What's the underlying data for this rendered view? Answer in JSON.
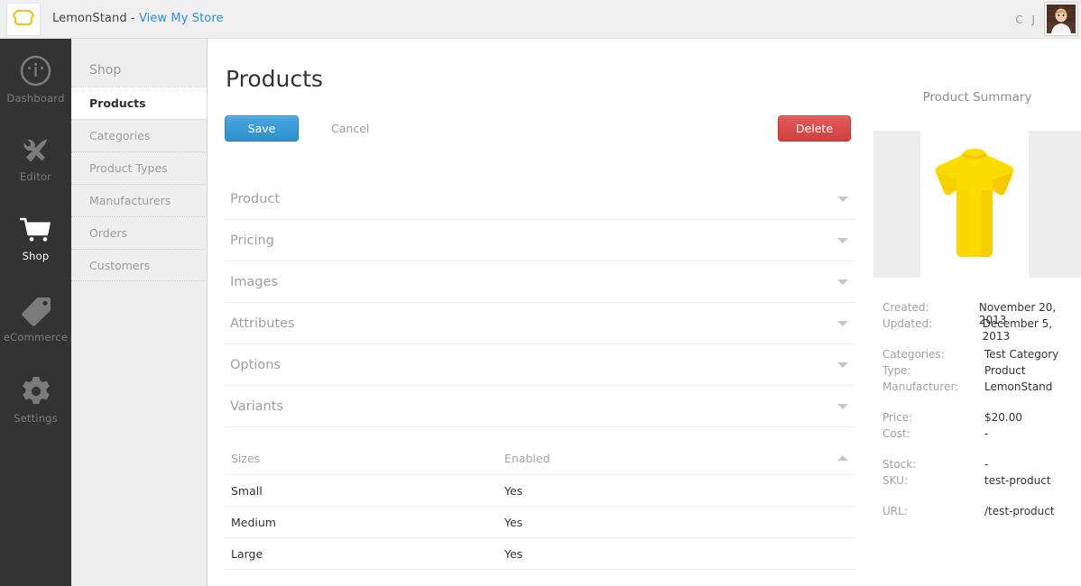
{
  "topbar": {
    "logo_icon": "lemonstand-lemon-logo-icon",
    "brand_name": "LemonStand - ",
    "store_link": "View My Store",
    "user_initials": "C J",
    "avatar_alt": "user-avatar"
  },
  "rail": {
    "items": [
      {
        "label": "Dashboard",
        "icon": "gauge-icon",
        "active": false
      },
      {
        "label": "Editor",
        "icon": "wrench-pencil-icon",
        "active": false
      },
      {
        "label": "Shop",
        "icon": "shopping-cart-icon",
        "active": true
      },
      {
        "label": "eCommerce",
        "icon": "price-tag-icon",
        "active": false
      },
      {
        "label": "Settings",
        "icon": "gear-icon",
        "active": false
      }
    ]
  },
  "subnav": {
    "title": "Shop",
    "items": [
      {
        "label": "Products",
        "active": true
      },
      {
        "label": "Categories",
        "active": false
      },
      {
        "label": "Product Types",
        "active": false
      },
      {
        "label": "Manufacturers",
        "active": false
      },
      {
        "label": "Orders",
        "active": false
      },
      {
        "label": "Customers",
        "active": false
      }
    ]
  },
  "main": {
    "page_title": "Products",
    "save_label": "Save",
    "cancel_label": "Cancel",
    "delete_label": "Delete",
    "sections": [
      {
        "label": "Product",
        "expanded": false
      },
      {
        "label": "Pricing",
        "expanded": false
      },
      {
        "label": "Images",
        "expanded": false
      },
      {
        "label": "Attributes",
        "expanded": false
      },
      {
        "label": "Options",
        "expanded": false
      },
      {
        "label": "Variants",
        "expanded": false
      }
    ],
    "variants_table": {
      "columns": [
        "Sizes",
        "Enabled"
      ],
      "rows": [
        {
          "size": "Small",
          "enabled": "Yes"
        },
        {
          "size": "Medium",
          "enabled": "Yes"
        },
        {
          "size": "Large",
          "enabled": "Yes"
        }
      ]
    }
  },
  "summary": {
    "title": "Product Summary",
    "image_alt": "yellow-t-shirt-product-image",
    "groups": [
      {
        "rows": [
          {
            "key": "Created:",
            "value": "November 20, 2013"
          },
          {
            "key": "Updated:",
            "value": "December 5, 2013"
          }
        ]
      },
      {
        "rows": [
          {
            "key": "Categories:",
            "value": "Test Category"
          },
          {
            "key": "Type:",
            "value": "Product"
          },
          {
            "key": "Manufacturer:",
            "value": "LemonStand"
          }
        ]
      },
      {
        "rows": [
          {
            "key": "Price:",
            "value": "$20.00"
          },
          {
            "key": "Cost:",
            "value": "-"
          }
        ]
      },
      {
        "rows": [
          {
            "key": "Stock:",
            "value": "-"
          },
          {
            "key": "SKU:",
            "value": "test-product"
          }
        ]
      },
      {
        "rows": [
          {
            "key": "URL:",
            "value": "/test-product"
          }
        ]
      }
    ]
  },
  "colors": {
    "rail_bg": "#333333",
    "subnav_bg": "#eeeeee",
    "accent_blue": "#2d8fd5",
    "danger_red": "#d03f3f",
    "logo_yellow": "#edc12e",
    "shirt_yellow": "#fcdc00"
  }
}
